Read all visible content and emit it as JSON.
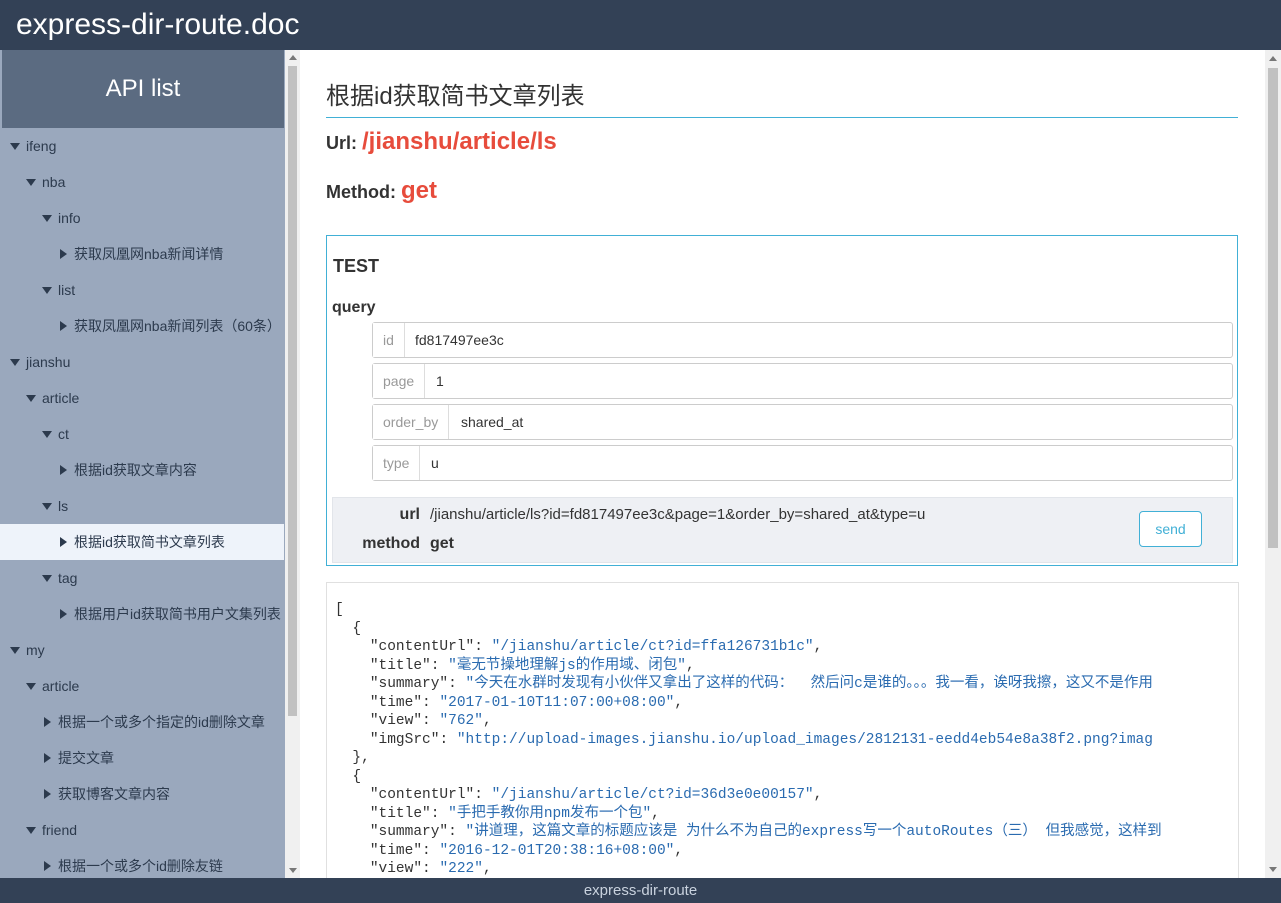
{
  "header": {
    "title": "express-dir-route.doc"
  },
  "sidebar": {
    "title": "API list",
    "items": [
      {
        "label": "ifeng",
        "level": 0,
        "type": "folder"
      },
      {
        "label": "nba",
        "level": 1,
        "type": "folder"
      },
      {
        "label": "info",
        "level": 2,
        "type": "folder"
      },
      {
        "label": "获取凤凰网nba新闻详情",
        "level": 3,
        "type": "api"
      },
      {
        "label": "list",
        "level": 2,
        "type": "folder"
      },
      {
        "label": "获取凤凰网nba新闻列表（60条）",
        "level": 3,
        "type": "api"
      },
      {
        "label": "jianshu",
        "level": 0,
        "type": "folder"
      },
      {
        "label": "article",
        "level": 1,
        "type": "folder"
      },
      {
        "label": "ct",
        "level": 2,
        "type": "folder"
      },
      {
        "label": "根据id获取文章内容",
        "level": 3,
        "type": "api"
      },
      {
        "label": "ls",
        "level": 2,
        "type": "folder"
      },
      {
        "label": "根据id获取简书文章列表",
        "level": 3,
        "type": "api",
        "active": true
      },
      {
        "label": "tag",
        "level": 2,
        "type": "folder"
      },
      {
        "label": "根据用户id获取简书用户文集列表",
        "level": 3,
        "type": "api"
      },
      {
        "label": "my",
        "level": 0,
        "type": "folder"
      },
      {
        "label": "article",
        "level": 1,
        "type": "folder"
      },
      {
        "label": "根据一个或多个指定的id删除文章",
        "level": 2,
        "type": "api"
      },
      {
        "label": "提交文章",
        "level": 2,
        "type": "api"
      },
      {
        "label": "获取博客文章内容",
        "level": 2,
        "type": "api"
      },
      {
        "label": "friend",
        "level": 1,
        "type": "folder"
      },
      {
        "label": "根据一个或多个id删除友链",
        "level": 2,
        "type": "api"
      }
    ]
  },
  "main": {
    "title": "根据id获取简书文章列表",
    "url_label": "Url:",
    "url_value": "/jianshu/article/ls",
    "method_label": "Method:",
    "method_value": "get",
    "test": {
      "title": "TEST",
      "query_label": "query",
      "fields": [
        {
          "label": "id",
          "value": "fd817497ee3c"
        },
        {
          "label": "page",
          "value": "1"
        },
        {
          "label": "order_by",
          "value": "shared_at"
        },
        {
          "label": "type",
          "value": "u"
        }
      ],
      "url_key": "url",
      "url_value": "/jianshu/article/ls?id=fd817497ee3c&page=1&order_by=shared_at&type=u",
      "method_key": "method",
      "method_value": "get",
      "send_label": "send"
    },
    "result": {
      "lines": [
        [
          [
            "p",
            "["
          ]
        ],
        [
          [
            "p",
            "  {"
          ]
        ],
        [
          [
            "p",
            "    "
          ],
          [
            "k",
            "\"contentUrl\""
          ],
          [
            "p",
            ": "
          ],
          [
            "s",
            "\"/jianshu/article/ct?id=ffa126731b1c\""
          ],
          [
            "p",
            ","
          ]
        ],
        [
          [
            "p",
            "    "
          ],
          [
            "k",
            "\"title\""
          ],
          [
            "p",
            ": "
          ],
          [
            "s",
            "\"毫无节操地理解js的作用域、闭包\""
          ],
          [
            "p",
            ","
          ]
        ],
        [
          [
            "p",
            "    "
          ],
          [
            "k",
            "\"summary\""
          ],
          [
            "p",
            ": "
          ],
          [
            "s",
            "\"今天在水群时发现有小伙伴又拿出了这样的代码：  然后问c是谁的。。。我一看，诶呀我擦，这又不是作用"
          ]
        ],
        [
          [
            "p",
            "    "
          ],
          [
            "k",
            "\"time\""
          ],
          [
            "p",
            ": "
          ],
          [
            "s",
            "\"2017-01-10T11:07:00+08:00\""
          ],
          [
            "p",
            ","
          ]
        ],
        [
          [
            "p",
            "    "
          ],
          [
            "k",
            "\"view\""
          ],
          [
            "p",
            ": "
          ],
          [
            "s",
            "\"762\""
          ],
          [
            "p",
            ","
          ]
        ],
        [
          [
            "p",
            "    "
          ],
          [
            "k",
            "\"imgSrc\""
          ],
          [
            "p",
            ": "
          ],
          [
            "s",
            "\"http://upload-images.jianshu.io/upload_images/2812131-eedd4eb54e8a38f2.png?imag"
          ]
        ],
        [
          [
            "p",
            "  },"
          ]
        ],
        [
          [
            "p",
            "  {"
          ]
        ],
        [
          [
            "p",
            "    "
          ],
          [
            "k",
            "\"contentUrl\""
          ],
          [
            "p",
            ": "
          ],
          [
            "s",
            "\"/jianshu/article/ct?id=36d3e0e00157\""
          ],
          [
            "p",
            ","
          ]
        ],
        [
          [
            "p",
            "    "
          ],
          [
            "k",
            "\"title\""
          ],
          [
            "p",
            ": "
          ],
          [
            "s",
            "\"手把手教你用npm发布一个包\""
          ],
          [
            "p",
            ","
          ]
        ],
        [
          [
            "p",
            "    "
          ],
          [
            "k",
            "\"summary\""
          ],
          [
            "p",
            ": "
          ],
          [
            "s",
            "\"讲道理，这篇文章的标题应该是 为什么不为自己的express写一个autoRoutes（三） 但我感觉，这样到"
          ]
        ],
        [
          [
            "p",
            "    "
          ],
          [
            "k",
            "\"time\""
          ],
          [
            "p",
            ": "
          ],
          [
            "s",
            "\"2016-12-01T20:38:16+08:00\""
          ],
          [
            "p",
            ","
          ]
        ],
        [
          [
            "p",
            "    "
          ],
          [
            "k",
            "\"view\""
          ],
          [
            "p",
            ": "
          ],
          [
            "s",
            "\"222\""
          ],
          [
            "p",
            ","
          ]
        ]
      ]
    }
  },
  "footer": {
    "text": "express-dir-route"
  }
}
